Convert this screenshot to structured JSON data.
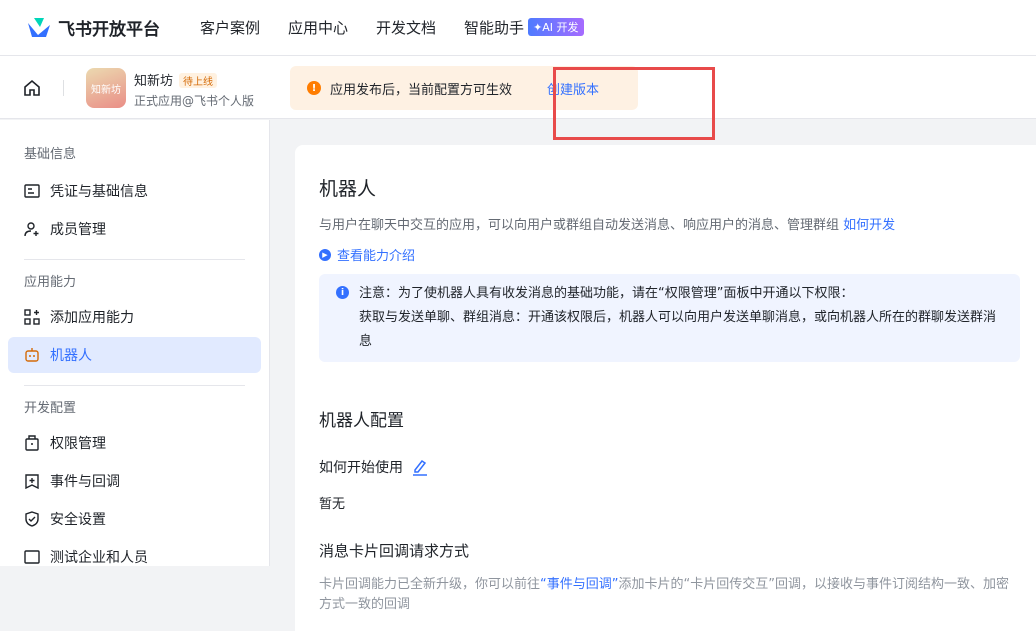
{
  "topnav": {
    "brand": "飞书开放平台",
    "items": [
      "客户案例",
      "应用中心",
      "开发文档",
      "智能助手"
    ],
    "ai_badge": "✦AI 开发"
  },
  "app": {
    "icon_text": "知新坊",
    "name": "知新坊",
    "status": "待上线",
    "type": "正式应用@飞书个人版"
  },
  "notice": {
    "text": "应用发布后，当前配置方可生效",
    "action": "创建版本"
  },
  "sidebar": {
    "sections": [
      {
        "title": "基础信息",
        "items": [
          "凭证与基础信息",
          "成员管理"
        ]
      },
      {
        "title": "应用能力",
        "items": [
          "添加应用能力",
          "机器人"
        ]
      },
      {
        "title": "开发配置",
        "items": [
          "权限管理",
          "事件与回调",
          "安全设置",
          "测试企业和人员"
        ]
      }
    ]
  },
  "main": {
    "title": "机器人",
    "desc": "与用户在聊天中交互的应用，可以向用户或群组自动发送消息、响应用户的消息、管理群组",
    "desc_link": "如何开发",
    "intro_link": "查看能力介绍",
    "info_line1": "注意：为了使机器人具有收发消息的基础功能，请在“权限管理”面板中开通以下权限：",
    "info_line2": "获取与发送单聊、群组消息：开通该权限后，机器人可以向用户发送单聊消息，或向机器人所在的群聊发送群消息",
    "config_title": "机器人配置",
    "howto": "如何开始使用",
    "howto_value": "暂无",
    "callback_title": "消息卡片回调请求方式",
    "callback_pre": "卡片回调能力已全新升级，你可以前往",
    "callback_link": "“事件与回调”",
    "callback_post": "添加卡片的“卡片回传交互”回调，以接收与事件订阅结构一致、加密方式一致的回调"
  }
}
